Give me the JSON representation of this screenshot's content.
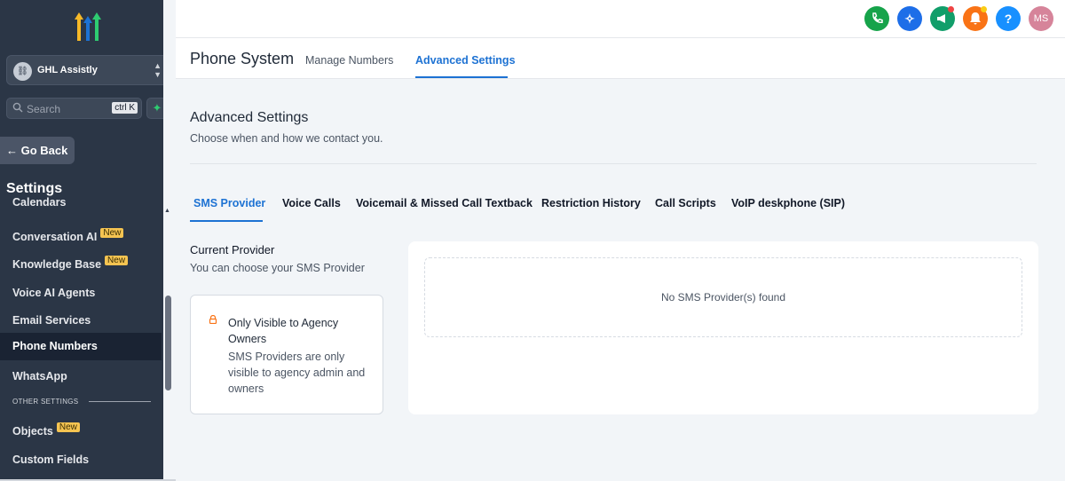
{
  "sidebar": {
    "account_name": "GHL Assistly",
    "search_placeholder": "Search",
    "search_shortcut": "ctrl K",
    "go_back": "Go Back",
    "settings_heading": "Settings",
    "items": [
      {
        "label": "Calendars",
        "badge": ""
      },
      {
        "label": "Conversation AI",
        "badge": "New"
      },
      {
        "label": "Knowledge Base",
        "badge": "New"
      },
      {
        "label": "Voice AI Agents",
        "badge": ""
      },
      {
        "label": "Email Services",
        "badge": ""
      },
      {
        "label": "Phone Numbers",
        "badge": ""
      },
      {
        "label": "WhatsApp",
        "badge": ""
      }
    ],
    "other_settings_label": "OTHER SETTINGS",
    "other_items": [
      {
        "label": "Objects",
        "badge": "New"
      },
      {
        "label": "Custom Fields",
        "badge": ""
      }
    ]
  },
  "topbar": {
    "avatar_initials": "MS",
    "help_label": "?",
    "colors": {
      "phone": "#16a34a",
      "magic": "#1d6ee8",
      "announce": "#119e6a",
      "notifications": "#f97316",
      "help": "#1890ff",
      "avatar": "#d6849a"
    }
  },
  "header": {
    "title": "Phone System",
    "tabs": [
      "Manage Numbers",
      "Advanced Settings"
    ]
  },
  "main": {
    "title": "Advanced Settings",
    "subtitle": "Choose when and how we contact you.",
    "tabs": [
      "SMS Provider",
      "Voice Calls",
      "Voicemail & Missed Call Textback",
      "Restriction History",
      "Call Scripts",
      "VoIP deskphone (SIP)"
    ],
    "current_provider_title": "Current Provider",
    "current_provider_sub": "You can choose your SMS Provider",
    "notice_title": "Only Visible to Agency Owners",
    "notice_body": "SMS Providers are only visible to agency admin and owners",
    "empty_text": "No SMS Provider(s) found"
  }
}
